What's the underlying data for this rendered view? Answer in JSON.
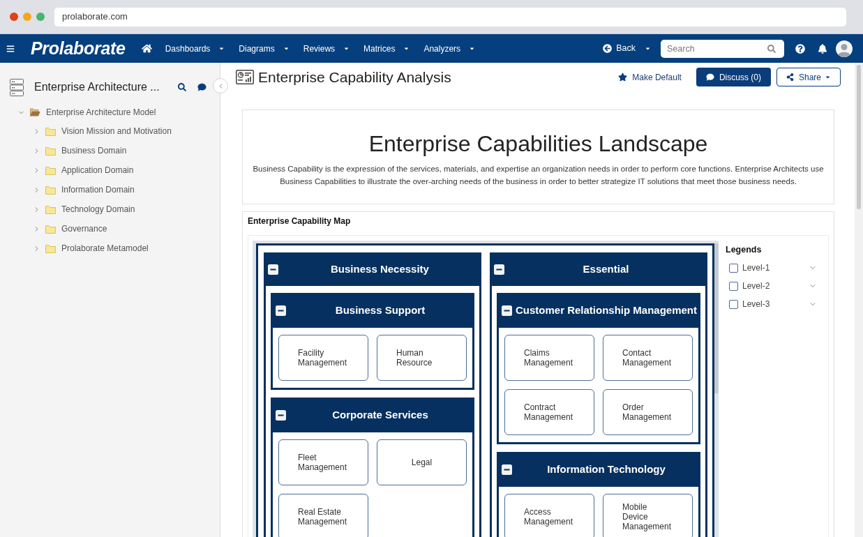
{
  "browser": {
    "url": "prolaborate.com"
  },
  "navbar": {
    "logo": "Prolaborate",
    "menus": [
      {
        "label": "Dashboards"
      },
      {
        "label": "Diagrams"
      },
      {
        "label": "Reviews"
      },
      {
        "label": "Matrices"
      },
      {
        "label": "Analyzers"
      }
    ],
    "back": "Back",
    "search": {
      "placeholder": "Search"
    }
  },
  "sidebar": {
    "title": "Enterprise Architecture ...",
    "tree": [
      {
        "label": "Enterprise Architecture Model",
        "expanded": true,
        "children": [
          {
            "label": "Vision Mission and Motivation",
            "expanded": false
          },
          {
            "label": "Business Domain",
            "expanded": false
          },
          {
            "label": "Application Domain",
            "expanded": false
          },
          {
            "label": "Information Domain",
            "expanded": false
          },
          {
            "label": "Technology Domain",
            "expanded": false
          },
          {
            "label": "Governance",
            "expanded": false
          },
          {
            "label": "Prolaborate Metamodel",
            "expanded": false
          }
        ]
      }
    ]
  },
  "page": {
    "title": "Enterprise Capability Analysis",
    "make_default": "Make Default",
    "discuss": "Discuss (0)",
    "share": "Share"
  },
  "intro": {
    "heading": "Enterprise Capabilities Landscape",
    "text": "Business Capability is the expression of the services, materials, and expertise an organization needs in order to perform core functions. Enterprise Architects use Business Capabilities to illustrate the over-arching needs of the business in order to better strategize IT solutions that meet those business needs."
  },
  "capability_map": {
    "title": "Enterprise Capability Map",
    "domains": [
      {
        "name": "Business Necessity",
        "expanded": true,
        "groups": [
          {
            "name": "Business Support",
            "expanded": true,
            "capabilities": [
              "Facility Management",
              "Human Resource"
            ]
          },
          {
            "name": "Corporate Services",
            "expanded": true,
            "capabilities": [
              "Fleet Management",
              "Legal",
              "Real Estate Management"
            ]
          }
        ]
      },
      {
        "name": "Essential",
        "expanded": true,
        "groups": [
          {
            "name": "Customer Relationship Management",
            "expanded": true,
            "capabilities": [
              "Claims Management",
              "Contact Management",
              "Contract Management",
              "Order Management"
            ]
          },
          {
            "name": "Information Technology",
            "expanded": true,
            "capabilities": [
              "Access Management",
              "Mobile Device Management"
            ]
          }
        ]
      }
    ],
    "legend": {
      "title": "Legends",
      "items": [
        {
          "label": "Level-1",
          "checked": false,
          "expanded": false
        },
        {
          "label": "Level-2",
          "checked": false,
          "expanded": false
        },
        {
          "label": "Level-3",
          "checked": false,
          "expanded": false
        }
      ]
    }
  }
}
